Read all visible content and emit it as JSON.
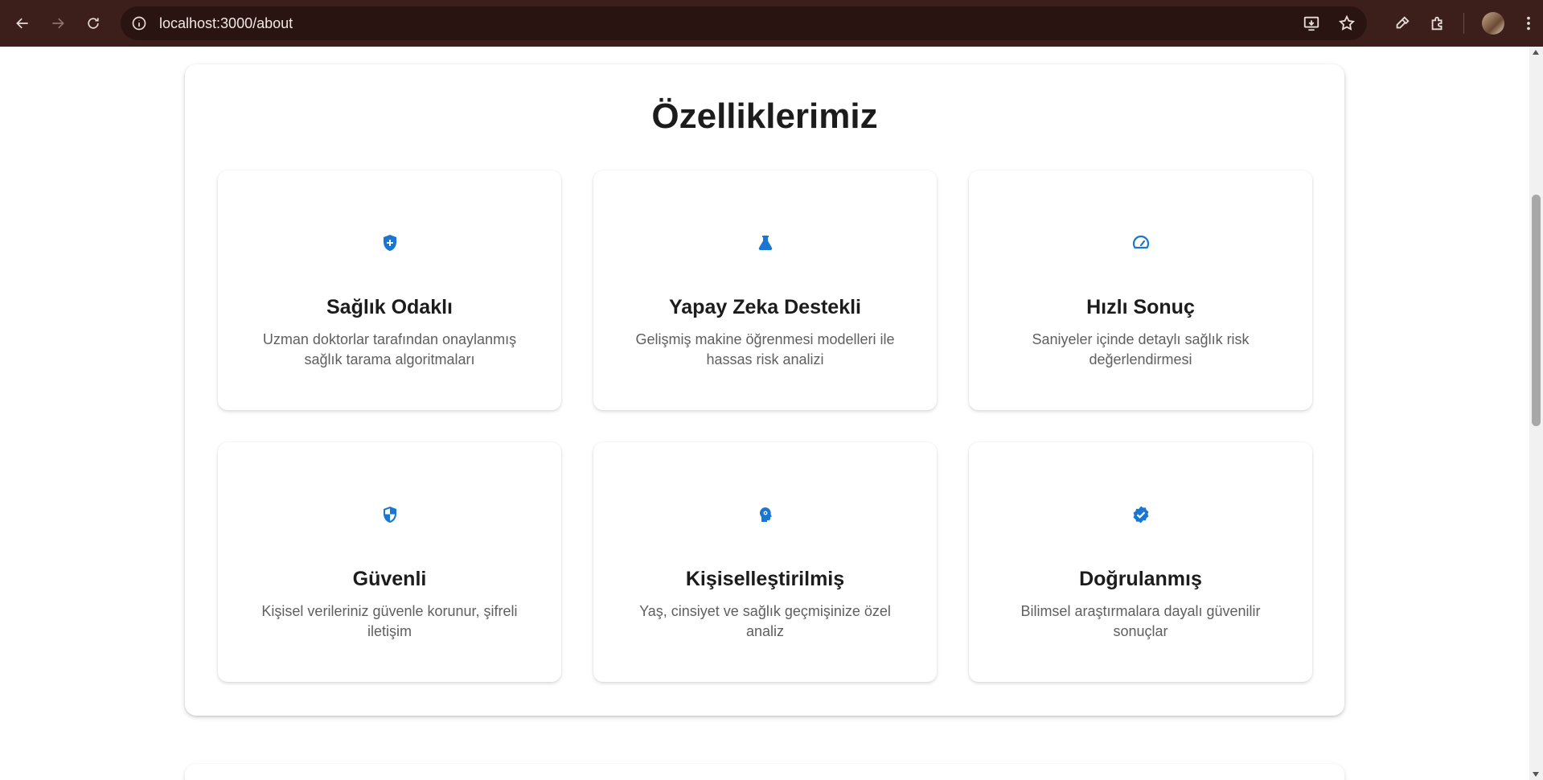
{
  "browser": {
    "url": "localhost:3000/about"
  },
  "page": {
    "section_title": "Özelliklerimiz",
    "features": [
      {
        "icon": "health-shield-icon",
        "title": "Sağlık Odaklı",
        "description": "Uzman doktorlar tarafından onaylanmış sağlık tarama algoritmaları"
      },
      {
        "icon": "flask-icon",
        "title": "Yapay Zeka Destekli",
        "description": "Gelişmiş makine öğrenmesi modelleri ile hassas risk analizi"
      },
      {
        "icon": "speedometer-icon",
        "title": "Hızlı Sonuç",
        "description": "Saniyeler içinde detaylı sağlık risk değerlendirmesi"
      },
      {
        "icon": "security-shield-icon",
        "title": "Güvenli",
        "description": "Kişisel verileriniz güvenle korunur, şifreli iletişim"
      },
      {
        "icon": "psychology-head-icon",
        "title": "Kişiselleştirilmiş",
        "description": "Yaş, cinsiyet ve sağlık geçmişinize özel analiz"
      },
      {
        "icon": "verified-badge-icon",
        "title": "Doğrulanmış",
        "description": "Bilimsel araştırmalara dayalı güvenilir sonuçlar"
      }
    ],
    "accent_color": "#1976d2"
  }
}
